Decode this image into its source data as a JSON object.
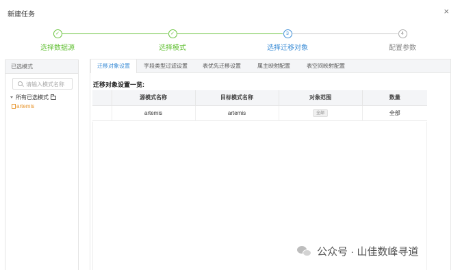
{
  "dialog": {
    "title": "新建任务",
    "close_symbol": "×"
  },
  "steps": [
    {
      "label": "选择数据源",
      "marker": "✓",
      "status": "done"
    },
    {
      "label": "选择模式",
      "marker": "✓",
      "status": "done"
    },
    {
      "label": "选择迁移对象",
      "marker": "3",
      "status": "active"
    },
    {
      "label": "配置参数",
      "marker": "4",
      "status": "wait"
    }
  ],
  "left_panel": {
    "header": "已选模式",
    "search": {
      "placeholder": "请输入模式名称",
      "value": ""
    },
    "tree_root": "所有已选模式",
    "tree_child": "artemis"
  },
  "tabs": [
    "迁移对象设置",
    "字段类型过滤设置",
    "表优先迁移设置",
    "属主映射配置",
    "表空间映射配置"
  ],
  "active_tab": "迁移对象设置",
  "section_title": "迁移对象设置一览:",
  "table": {
    "columns": [
      "",
      "源模式名称",
      "目标模式名称",
      "对象范围",
      "数量"
    ],
    "rows": [
      {
        "source": "artemis",
        "target": "artemis",
        "scope": "全部",
        "count": "全部"
      }
    ]
  },
  "watermark": {
    "text": "公众号 · 山佳数峰寻道"
  },
  "colors": {
    "done": "#67c23a",
    "active": "#3c8dd6",
    "wait": "#888888",
    "tree_child": "#e8962f"
  }
}
